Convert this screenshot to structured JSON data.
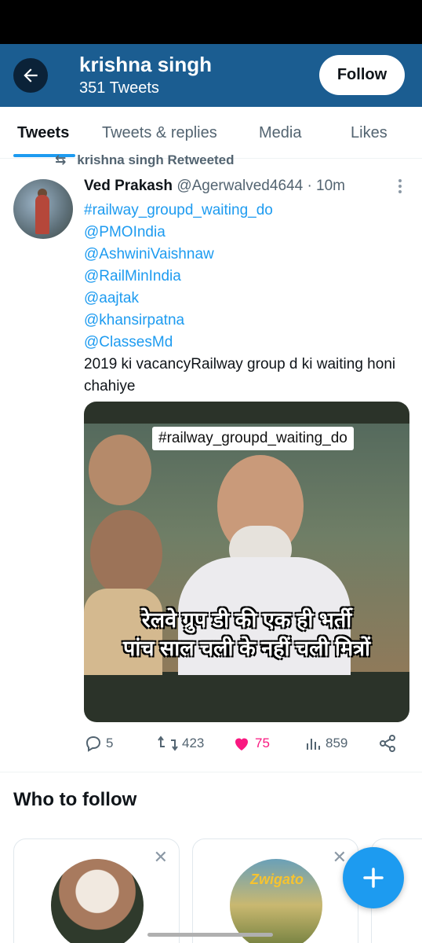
{
  "header": {
    "name": "krishna singh",
    "tweet_count": "351 Tweets",
    "follow_label": "Follow",
    "bg_color": "#1b5d91"
  },
  "tabs": [
    {
      "label": "Tweets",
      "active": true
    },
    {
      "label": "Tweets & replies",
      "active": false
    },
    {
      "label": "Media",
      "active": false
    },
    {
      "label": "Likes",
      "active": false
    }
  ],
  "tweet": {
    "retweet_label": "krishna singh Retweeted",
    "author_name": "Ved Prakash",
    "author_handle": "@Agerwalved4644",
    "time": "· 10m",
    "links": [
      "#railway_groupd_waiting_do",
      "@PMOIndia",
      "@AshwiniVaishnaw",
      "@RailMinIndia",
      "@aajtak",
      "@khansirpatna",
      "@ClassesMd"
    ],
    "text": "2019 ki vacancyRailway group d ki waiting honi chahiye",
    "media": {
      "tag": "#railway_groupd_waiting_do",
      "caption_line1": "रेलवे ग्रुप डी की एक ही भर्ती",
      "caption_line2": "पांच साल चली के नहीं चली मित्रों"
    },
    "stats": {
      "replies": "5",
      "retweets": "423",
      "likes": "75",
      "views": "859"
    }
  },
  "who_to_follow": {
    "title": "Who to follow",
    "card2_logo_text": "Zwigato"
  },
  "colors": {
    "accent": "#1d9bf0",
    "like": "#f91880"
  }
}
